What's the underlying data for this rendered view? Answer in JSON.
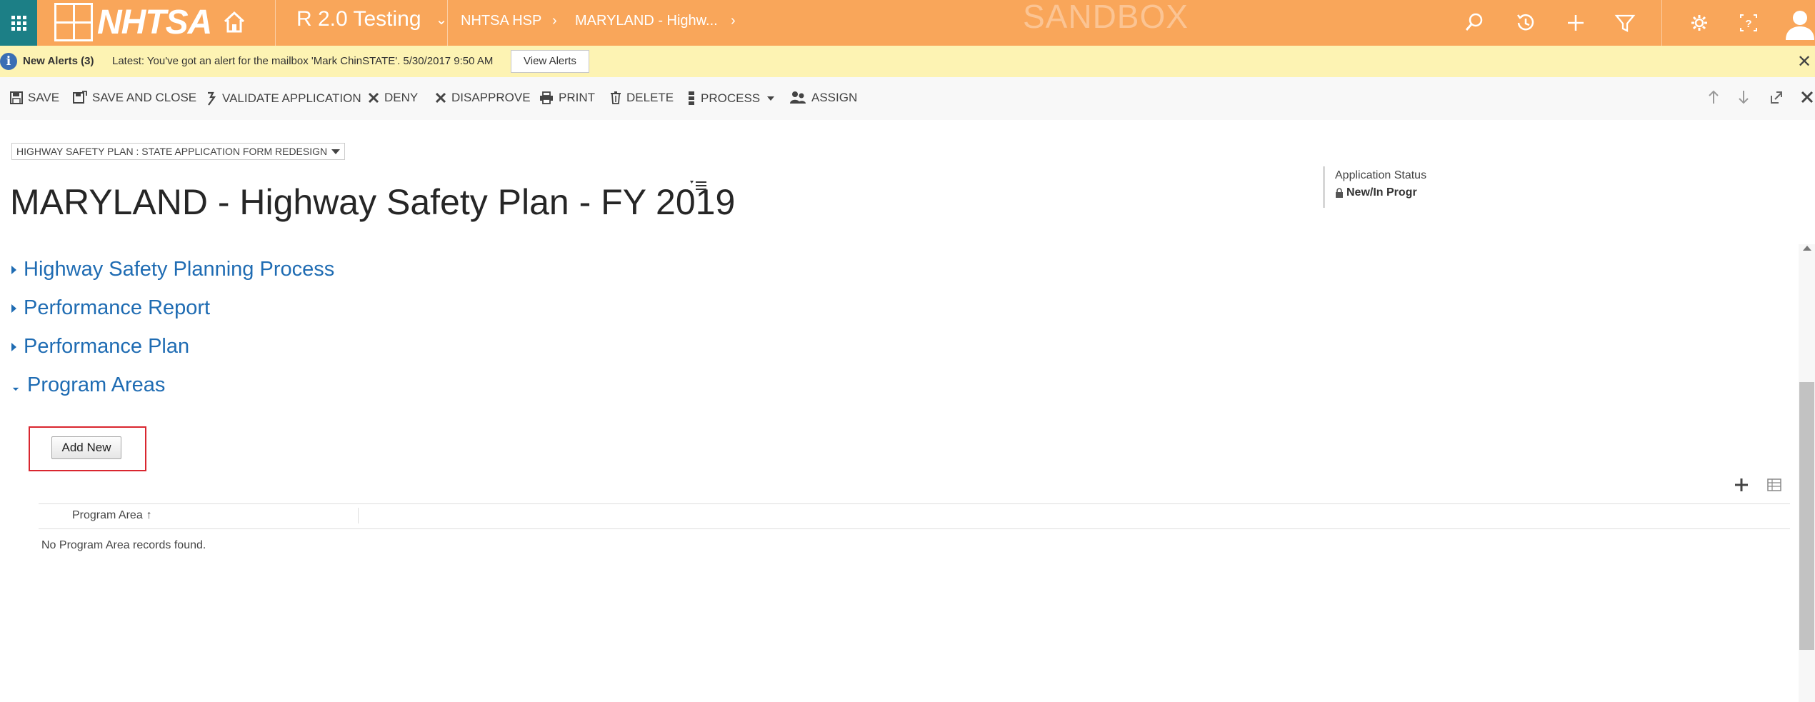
{
  "topbar": {
    "logo_text": "NHTSA",
    "app_name": "R 2.0 Testing",
    "crumb_area": "NHTSA HSP",
    "crumb_record": "MARYLAND - Highw...",
    "sandbox": "SANDBOX",
    "colors": {
      "bar": "#f9a65a",
      "waffle": "#1c7f86"
    },
    "icons": [
      "search-icon",
      "history-icon",
      "plus-icon",
      "filter-icon",
      "gear-icon",
      "help-icon",
      "user-icon"
    ]
  },
  "alert": {
    "title": "New Alerts (3)",
    "message": "Latest: You've got an alert for the mailbox 'Mark ChinSTATE'. 5/30/2017 9:50 AM",
    "button": "View Alerts"
  },
  "commands": [
    {
      "label": "SAVE",
      "icon": "save-icon"
    },
    {
      "label": "SAVE AND CLOSE",
      "icon": "save-close-icon"
    },
    {
      "label": "VALIDATE APPLICATION",
      "icon": "validate-icon"
    },
    {
      "label": "DENY",
      "icon": "x-icon"
    },
    {
      "label": "DISAPPROVE",
      "icon": "x-icon"
    },
    {
      "label": "PRINT",
      "icon": "print-icon"
    },
    {
      "label": "DELETE",
      "icon": "trash-icon"
    },
    {
      "label": "PROCESS",
      "icon": "process-icon"
    },
    {
      "label": "ASSIGN",
      "icon": "assign-icon"
    }
  ],
  "header": {
    "form_selector": "HIGHWAY SAFETY PLAN : STATE APPLICATION FORM REDESIGN",
    "title": "MARYLAND - Highway Safety Plan - FY 2019",
    "status_label": "Application Status",
    "status_value": "New/In Progr"
  },
  "sections": [
    {
      "label": "Highway Safety Planning Process",
      "expanded": false
    },
    {
      "label": "Performance Report",
      "expanded": false
    },
    {
      "label": "Performance Plan",
      "expanded": false
    },
    {
      "label": "Program Areas",
      "expanded": true
    }
  ],
  "program_areas": {
    "add_button": "Add New",
    "column_header": "Program Area",
    "sort_arrow": "↑",
    "empty_text": "No Program Area records found."
  }
}
